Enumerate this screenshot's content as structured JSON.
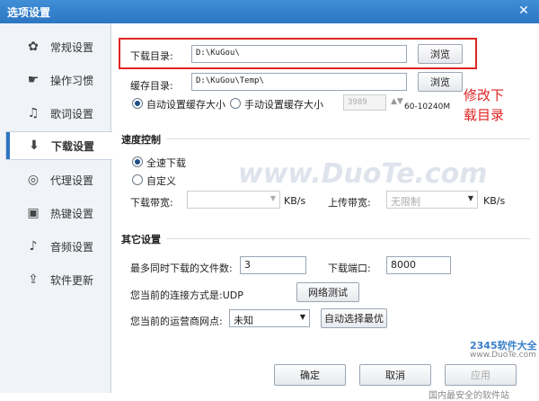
{
  "window": {
    "title": "选项设置",
    "close_glyph": "✕"
  },
  "sidebar": {
    "items": [
      {
        "label": "常规设置",
        "icon": "gear-icon",
        "glyph": "✿"
      },
      {
        "label": "操作习惯",
        "icon": "hand-icon",
        "glyph": "☛"
      },
      {
        "label": "歌词设置",
        "icon": "lyrics-icon",
        "glyph": "♫"
      },
      {
        "label": "下载设置",
        "icon": "download-icon",
        "glyph": "⬇"
      },
      {
        "label": "代理设置",
        "icon": "globe-icon",
        "glyph": "◎"
      },
      {
        "label": "热键设置",
        "icon": "hotkey-icon",
        "glyph": "▣"
      },
      {
        "label": "音频设置",
        "icon": "equalizer-icon",
        "glyph": "♪"
      },
      {
        "label": "软件更新",
        "icon": "update-icon",
        "glyph": "⇪"
      }
    ],
    "active_index": 3
  },
  "download": {
    "dir_label": "下载目录:",
    "dir_value": "D:\\KuGou\\",
    "browse_label": "浏览",
    "cache_label": "缓存目录:",
    "cache_value": "D:\\KuGou\\Temp\\",
    "auto_cache_label": "自动设置缓存大小",
    "manual_cache_label": "手动设置缓存大小",
    "cache_size_value": "3989",
    "cache_range": "60-10240M"
  },
  "speed": {
    "section_title": "速度控制",
    "full_speed_label": "全速下载",
    "custom_label": "自定义",
    "down_bw_label": "下载带宽:",
    "down_bw_value": "",
    "up_bw_label": "上传带宽:",
    "up_bw_value": "无限制",
    "unit": "KB/s"
  },
  "other": {
    "section_title": "其它设置",
    "max_files_label": "最多同时下载的文件数:",
    "max_files_value": "3",
    "port_label": "下载端口:",
    "port_value": "8000",
    "conn_label": "您当前的连接方式是:UDP",
    "net_test_label": "网络测试",
    "isp_label": "您当前的运营商网点:",
    "isp_value": "未知",
    "auto_select_label": "自动选择最优"
  },
  "footer": {
    "ok_label": "确定",
    "cancel_label": "取消",
    "apply_label": "应用"
  },
  "annotation": {
    "line1": "修改下",
    "line2": "载目录"
  },
  "watermarks": {
    "center": "www.DuoTe.com",
    "brand": "2345软件大全",
    "brand_url": "www.DuoTe.com",
    "bottom": "国内最安全的软件站"
  },
  "colors": {
    "accent": "#2c76c2",
    "annotation": "#e02424"
  }
}
